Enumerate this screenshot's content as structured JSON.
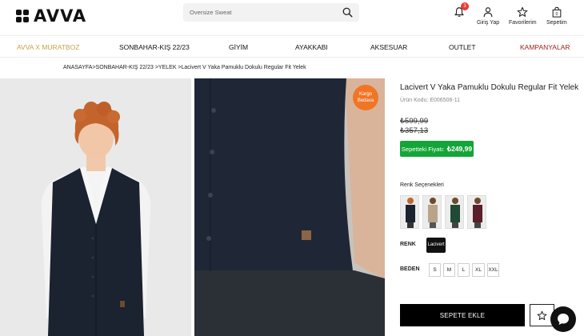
{
  "brand": {
    "logo_text": "AVVA"
  },
  "search": {
    "placeholder": "Oversize Sweat"
  },
  "header": {
    "notification_count": "3",
    "login_label": "Giriş Yap",
    "favorites_label": "Favorilerim",
    "cart_label": "Sepetim",
    "cart_count": "0"
  },
  "nav": {
    "items": [
      "AVVA X MURATBOZ",
      "SONBAHAR-KIŞ 22/23",
      "GİYİM",
      "AYAKKABI",
      "AKSESUAR",
      "OUTLET",
      "KAMPANYALAR"
    ]
  },
  "breadcrumb": "ANASAYFA>SONBAHAR-KIŞ 22/23 >YELEK >Lacivert V Yaka Pamuklu Dokulu Regular Fit Yelek",
  "badge": {
    "line1": "Kargo",
    "line2": "Bedava"
  },
  "product": {
    "title": "Lacivert V Yaka Pamuklu Dokulu Regular Fit Yelek",
    "code": "Ürün Kodu: E006506-11",
    "old_price_1": "₺599,99",
    "old_price_2": "₺357,13",
    "cart_price_label": "Sepetteki Fiyatı:",
    "cart_price_value": "₺249,99",
    "color_options_title": "Renk Seçenekleri",
    "color_label": "RENK",
    "selected_color": "Lacivert",
    "size_label": "BEDEN",
    "sizes": [
      "S",
      "M",
      "L",
      "XL",
      "XXL"
    ],
    "add_to_cart": "SEPETE EKLE"
  },
  "colors": {
    "accent_gold": "#c8a24a",
    "campaign_red": "#a41e1e",
    "cart_price_green": "#13a538",
    "badge_orange": "#f07525"
  }
}
